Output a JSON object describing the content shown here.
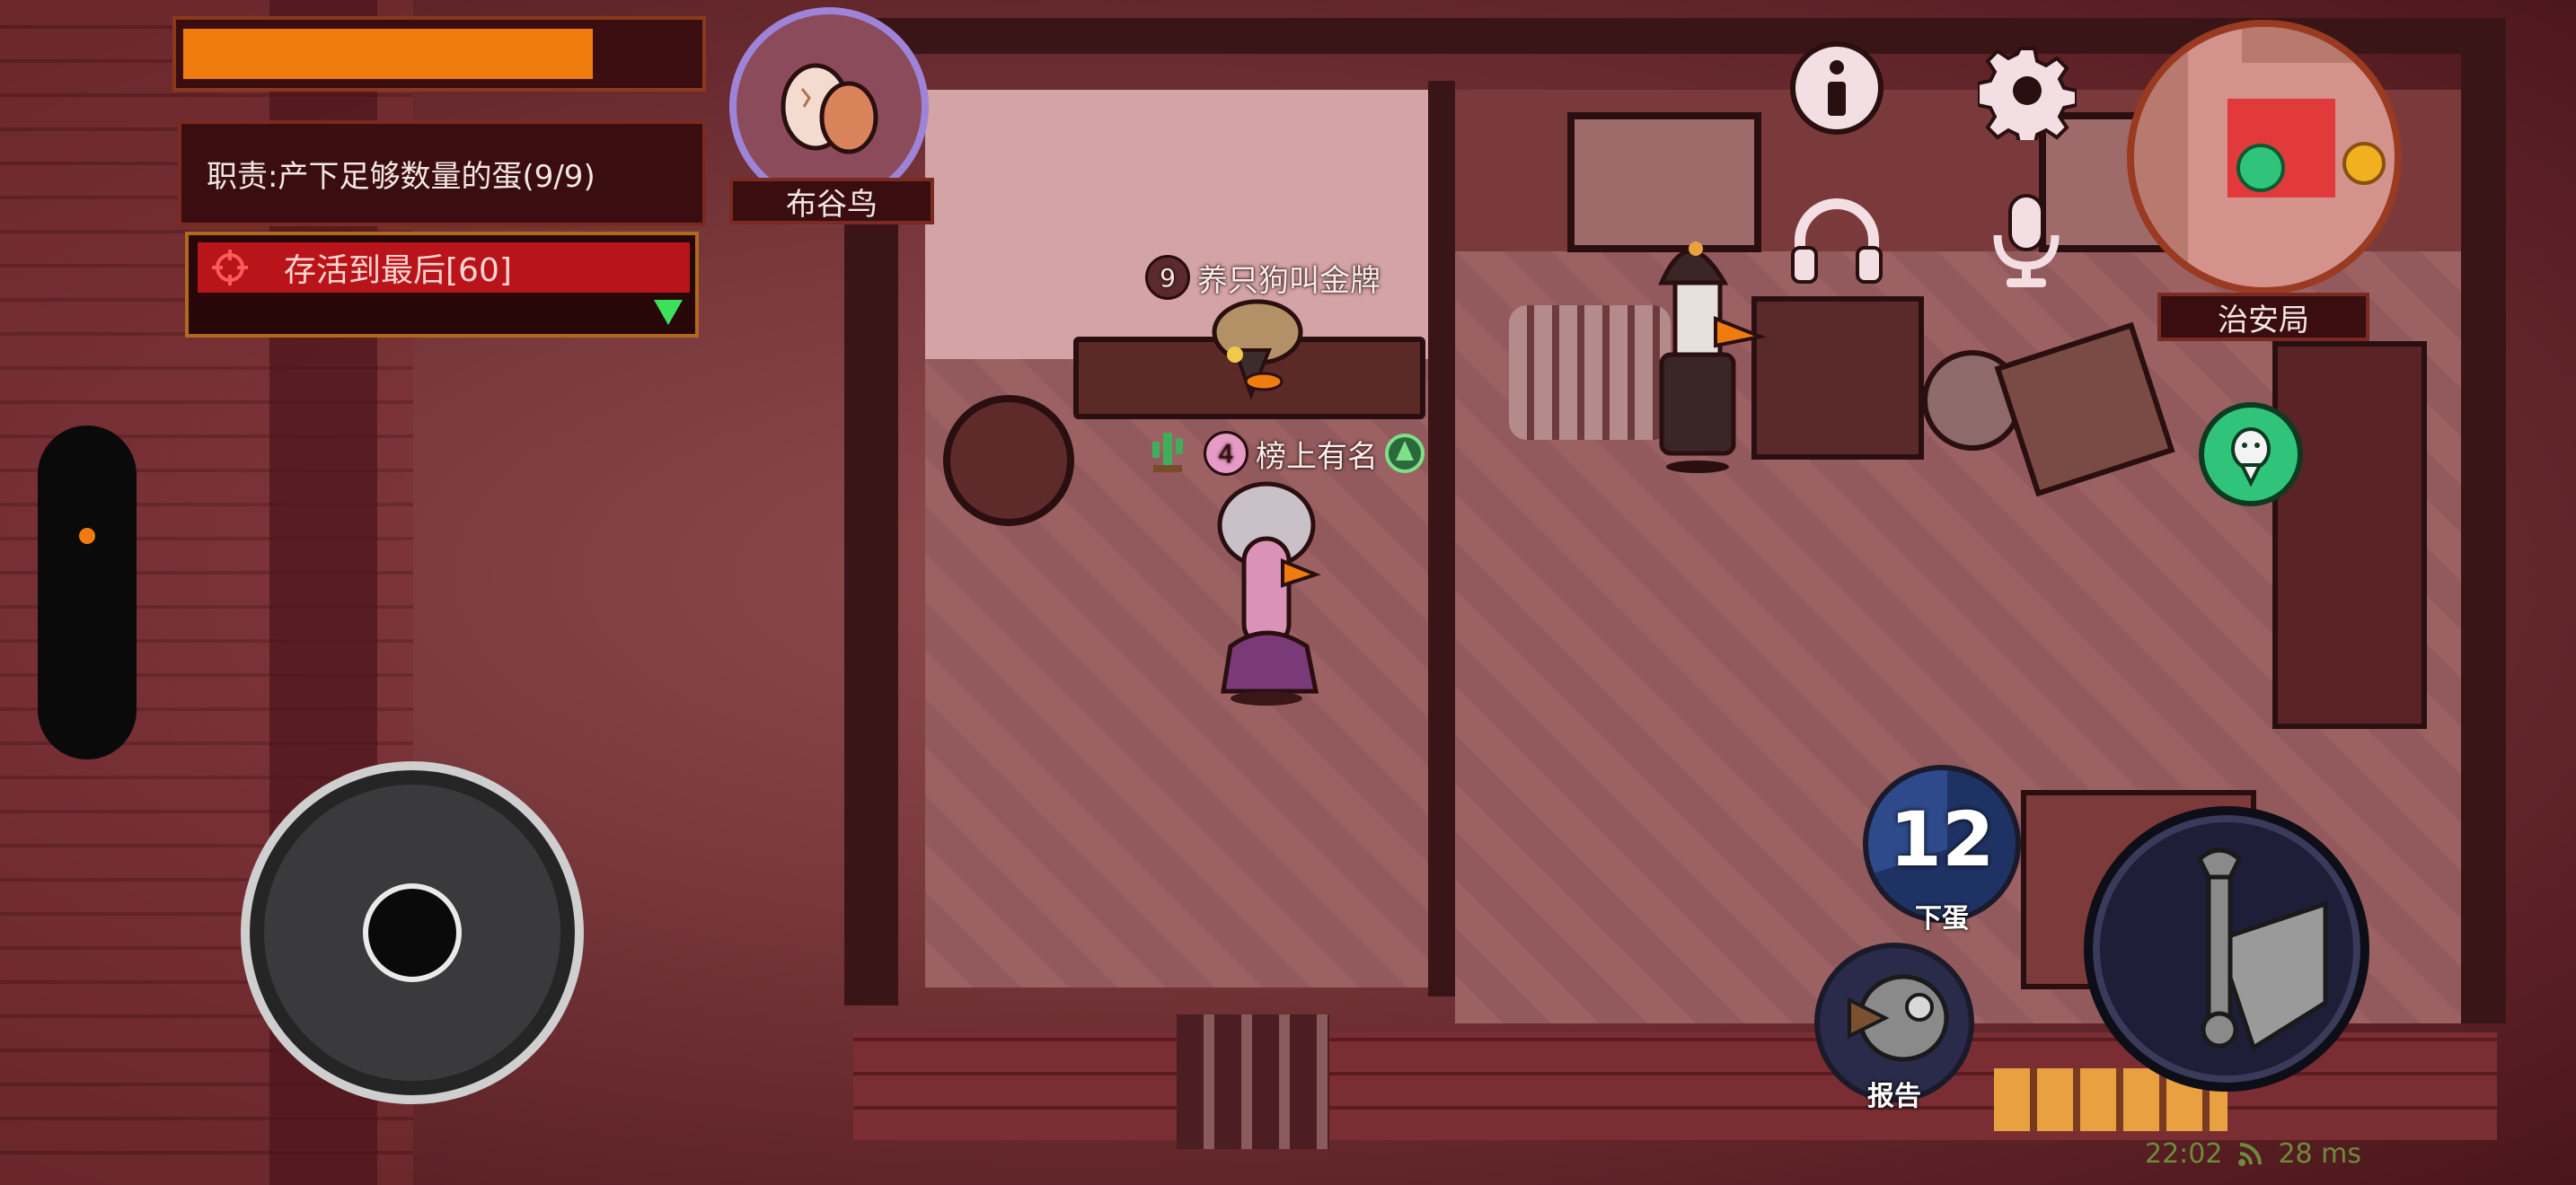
{
  "hud": {
    "health_fraction": 0.8,
    "duty_text": "职责:产下足够数量的蛋(9/9)",
    "objective_text": "存活到最后[60]",
    "role_name": "布谷鸟",
    "location_name": "治安局",
    "status_time": "22:02",
    "status_ping": "28 ms"
  },
  "players": [
    {
      "level": "9",
      "name": "养只狗叫金牌"
    },
    {
      "level": "4",
      "name": "榜上有名"
    }
  ],
  "actions": {
    "lay_egg": {
      "label": "下蛋",
      "cooldown": "12"
    },
    "report": {
      "label": "报告"
    }
  },
  "icons": [
    "info-icon",
    "settings-gear-icon",
    "headphones-icon",
    "microphone-icon",
    "chat-goose-icon",
    "wrench-icon",
    "crosshair-icon",
    "egg-icon"
  ],
  "colors": {
    "health": "#f07c10",
    "objective_bg": "#b8141a",
    "accent_green": "#2fc47a",
    "hud_border": "#8a3a1a"
  }
}
